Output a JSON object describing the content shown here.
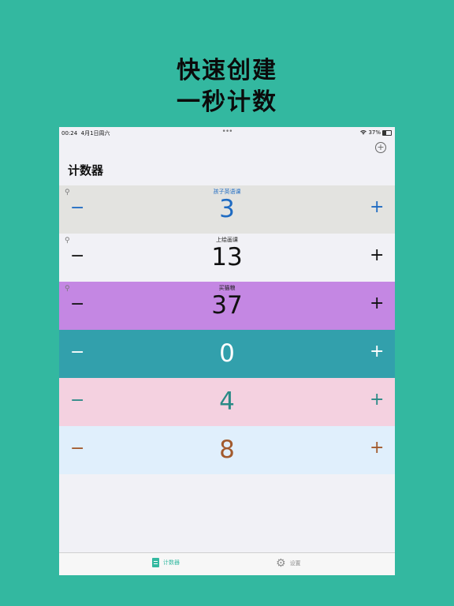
{
  "headline": {
    "line1": "快速创建",
    "line2": "一秒计数"
  },
  "status_bar": {
    "time": "00:24",
    "date": "4月1日周六",
    "dots": "•••",
    "battery_text": "37%",
    "battery_level": 0.37
  },
  "add_icon": "plus-circle-icon",
  "page_title": "计数器",
  "counters": [
    {
      "name": "孩子英语课",
      "value": "3",
      "pinned": true,
      "bg": "#E3E3E0",
      "fg": "#1F6BC2"
    },
    {
      "name": "上绘画课",
      "value": "13",
      "pinned": true,
      "bg": "#F1F1F6",
      "fg": "#111111"
    },
    {
      "name": "买猫粮",
      "value": "37",
      "pinned": true,
      "bg": "#C487E3",
      "fg": "#111111"
    },
    {
      "name": "",
      "value": "0",
      "pinned": false,
      "bg": "#32A0AC",
      "fg": "#FFFFFF"
    },
    {
      "name": "",
      "value": "4",
      "pinned": false,
      "bg": "#F4D1E0",
      "fg": "#2A8A86"
    },
    {
      "name": "",
      "value": "8",
      "pinned": false,
      "bg": "#E0EFFC",
      "fg": "#A25A2D"
    }
  ],
  "controls": {
    "minus": "−",
    "plus": "+",
    "pin_icon": "pin-icon"
  },
  "tabs": [
    {
      "label": "计数器",
      "icon": "document-icon",
      "active": true
    },
    {
      "label": "设置",
      "icon": "gear-icon",
      "active": false
    }
  ],
  "colors": {
    "background": "#33B8A0",
    "accent": "#33B8A0"
  }
}
